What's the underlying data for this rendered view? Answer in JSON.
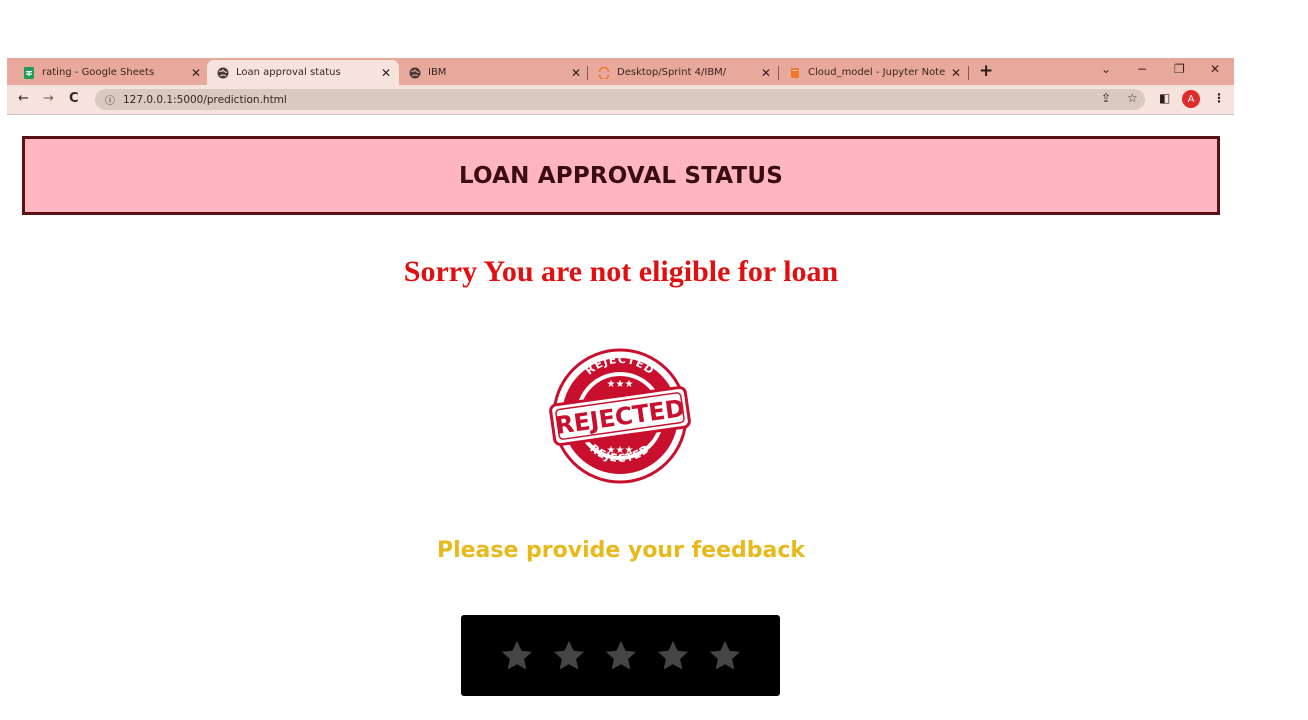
{
  "browser": {
    "tabs": [
      {
        "title": "rating - Google Sheets",
        "icon": "google-sheets-icon"
      },
      {
        "title": "Loan approval status",
        "icon": "globe-icon"
      },
      {
        "title": "IBM",
        "icon": "globe-icon"
      },
      {
        "title": "Desktop/Sprint 4/IBM/",
        "icon": "jupyter-icon"
      },
      {
        "title": "Cloud_model - Jupyter Notebook",
        "icon": "jupyter-notebook-icon"
      }
    ],
    "url": "127.0.0.1:5000/prediction.html",
    "profile_initial": "A"
  },
  "page": {
    "header_title": "LOAN APPROVAL STATUS",
    "message": "Sorry You are not eligible for loan",
    "stamp": {
      "main_text": "REJECTED",
      "color": "#c8102e"
    },
    "feedback_prompt": "Please provide your feedback",
    "rating": {
      "max_stars": 5,
      "selected": 0,
      "star_color": "#454545"
    }
  },
  "colors": {
    "header_bg": "#ffb6c1",
    "header_border": "#5c0f14",
    "message": "#e01010",
    "feedback": "#e8b91b",
    "tabstrip": "#e8a89c"
  }
}
